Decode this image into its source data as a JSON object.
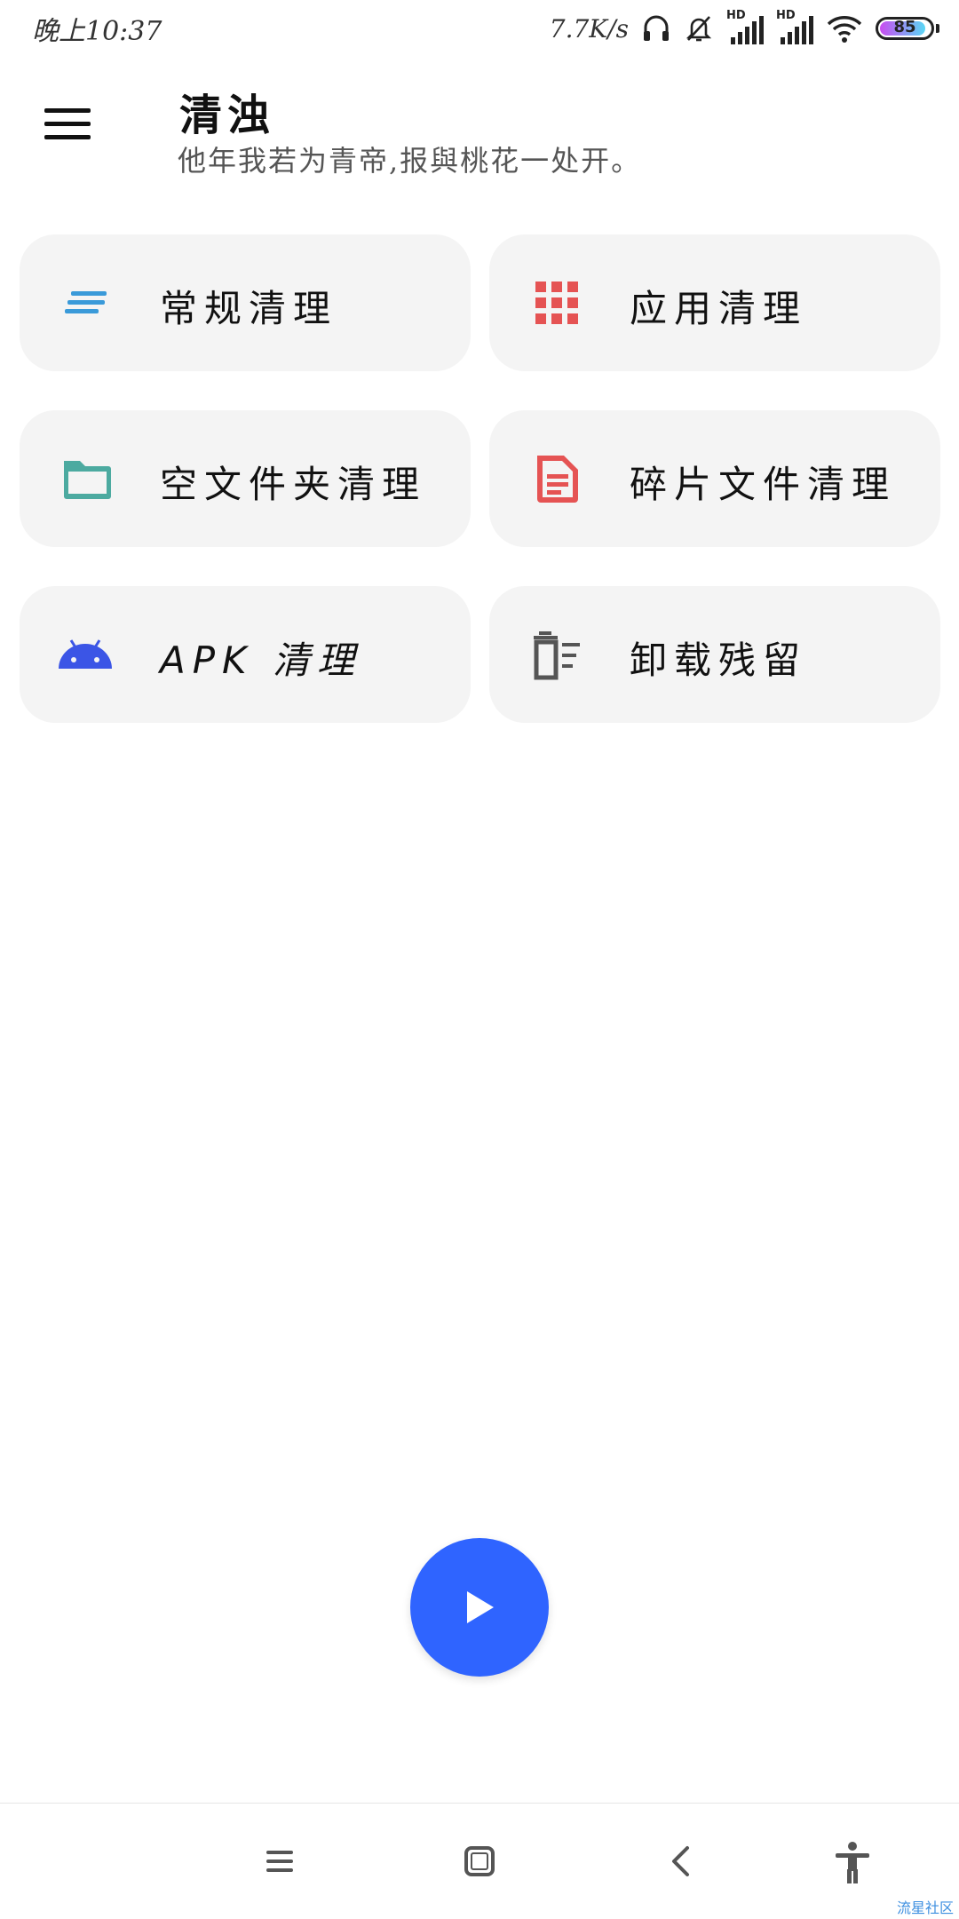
{
  "status_bar": {
    "time": "晚上10:37",
    "network_speed": "7.7K/s",
    "signal_1_label": "HD",
    "signal_2_label": "HD",
    "battery_level": "85",
    "icons": [
      "headphones-icon",
      "mute-icon",
      "signal-icon",
      "signal-icon",
      "wifi-icon",
      "battery-icon"
    ]
  },
  "header": {
    "menu_icon": "hamburger-menu-icon",
    "title": "清浊",
    "subtitle": "他年我若为青帝,报與桃花一处开。"
  },
  "cards": [
    {
      "label": "常规清理",
      "icon": "lines-icon",
      "color": "#3a9ad9"
    },
    {
      "label": "应用清理",
      "icon": "apps-grid-icon",
      "color": "#e55353"
    },
    {
      "label": "空文件夹清理",
      "icon": "folder-icon",
      "color": "#4caaa0"
    },
    {
      "label": "碎片文件清理",
      "icon": "document-icon",
      "color": "#e55353"
    },
    {
      "label": "APK 清理",
      "icon": "android-icon",
      "color": "#3b55e6"
    },
    {
      "label": "卸载残留",
      "icon": "trash-list-icon",
      "color": "#555555"
    }
  ],
  "fab": {
    "icon": "play-icon",
    "color": "#2f64ff"
  },
  "nav_bar": {
    "icons": [
      "menu-nav-icon",
      "home-nav-icon",
      "back-nav-icon",
      "accessibility-icon"
    ],
    "watermark": "流星社区"
  }
}
